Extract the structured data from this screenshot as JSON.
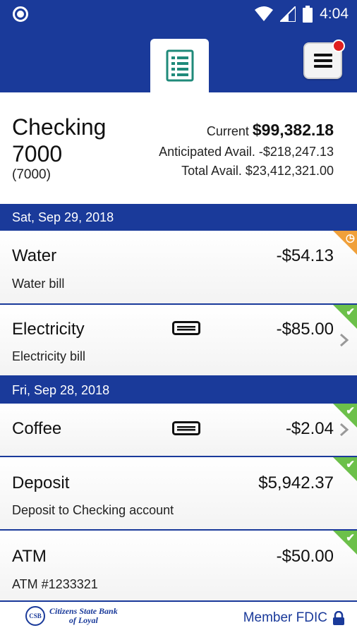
{
  "status_bar": {
    "time": "4:04",
    "icons": [
      "circle-indicator-icon",
      "wifi-icon",
      "signal-icon",
      "battery-icon"
    ]
  },
  "header": {
    "active_tab_icon": "ledger-icon",
    "menu_icon": "hamburger-menu-icon",
    "menu_has_notification": true,
    "colors": {
      "brand": "#1a3a9a",
      "notification": "#e02020"
    }
  },
  "account": {
    "name": "Checking 7000",
    "number": "(7000)",
    "current_label": "Current",
    "current_value": "$99,382.18",
    "anticipated_label": "Anticipated Avail.",
    "anticipated_value": "-$218,247.13",
    "total_label": "Total Avail.",
    "total_value": "$23,412,321.00"
  },
  "groups": [
    {
      "date": "Sat, Sep 29, 2018",
      "transactions": [
        {
          "name": "Water",
          "description": "Water bill",
          "amount": "-$54.13",
          "status": "pending",
          "card": false,
          "chevron": false
        },
        {
          "name": "Electricity",
          "description": "Electricity bill",
          "amount": "-$85.00",
          "status": "cleared",
          "card": true,
          "chevron": true
        }
      ]
    },
    {
      "date": "Fri, Sep 28, 2018",
      "transactions": [
        {
          "name": "Coffee",
          "description": "",
          "amount": "-$2.04",
          "status": "cleared",
          "card": true,
          "chevron": true
        },
        {
          "name": "Deposit",
          "description": "Deposit to Checking account",
          "amount": "$5,942.37",
          "status": "cleared",
          "card": false,
          "chevron": false
        },
        {
          "name": "ATM",
          "description": "ATM #1233321",
          "amount": "-$50.00",
          "status": "cleared",
          "card": false,
          "chevron": false
        }
      ]
    }
  ],
  "status_colors": {
    "cleared": "#6cc04a",
    "pending": "#f0a03a"
  },
  "footer": {
    "bank_logo": "Citizens State Bank of Loyal",
    "fdic_text": "Member FDIC",
    "lock_icon": "lock-icon"
  }
}
